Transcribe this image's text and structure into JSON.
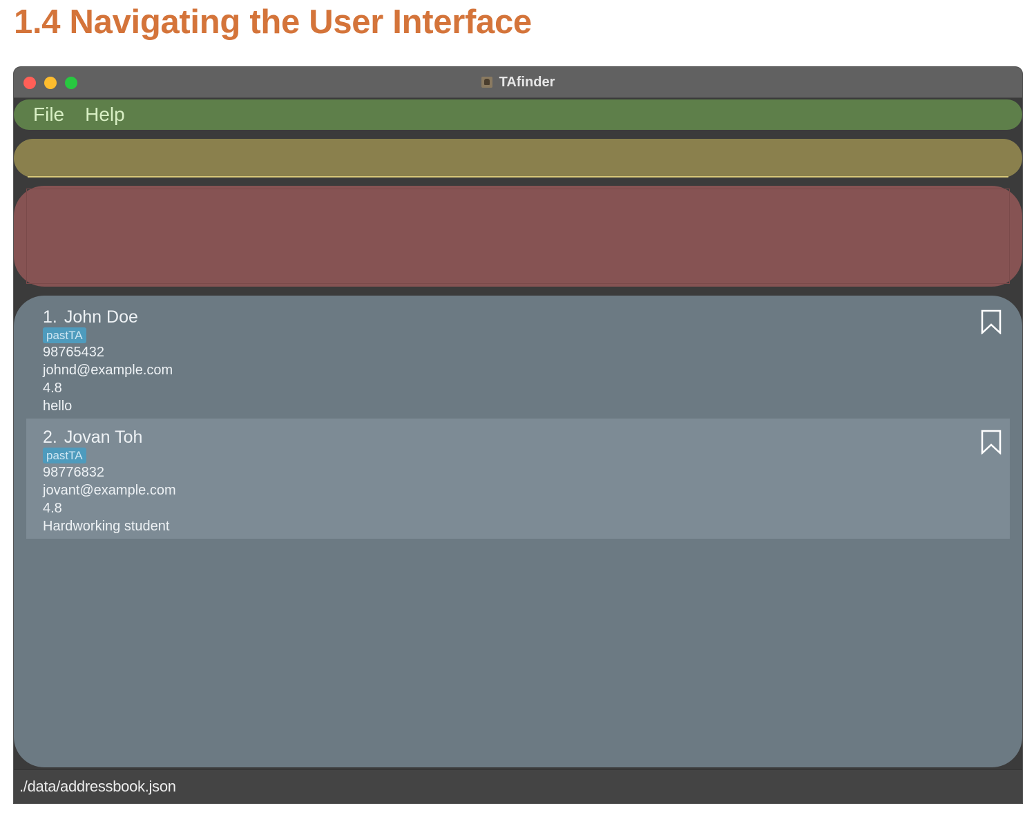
{
  "page": {
    "heading": "1.4 Navigating the User Interface"
  },
  "window": {
    "title": "TAfinder",
    "app_icon": "contact-book-icon"
  },
  "menubar": {
    "items": [
      {
        "label": "File"
      },
      {
        "label": "Help"
      }
    ]
  },
  "command_box": {
    "value": "",
    "placeholder": ""
  },
  "result_display": {
    "text": ""
  },
  "persons": [
    {
      "index": "1.",
      "name": "John Doe",
      "tag": "pastTA",
      "phone": "98765432",
      "email": "johnd@example.com",
      "rating": "4.8",
      "remark": "hello",
      "bookmark_icon": "bookmark-outline-icon"
    },
    {
      "index": "2.",
      "name": "Jovan Toh",
      "tag": "pastTA",
      "phone": "98776832",
      "email": "jovant@example.com",
      "rating": "4.8",
      "remark": "Hardworking student",
      "bookmark_icon": "bookmark-outline-icon"
    }
  ],
  "statusbar": {
    "path": "./data/addressbook.json"
  },
  "colors": {
    "heading": "#d4743a",
    "menubar": "#5e7f4a",
    "command_box": "#8a804d",
    "result_display": "#865353",
    "person_list": "#6c7a83",
    "selected_card": "#7d8b95",
    "tag": "#4e9bbd"
  }
}
